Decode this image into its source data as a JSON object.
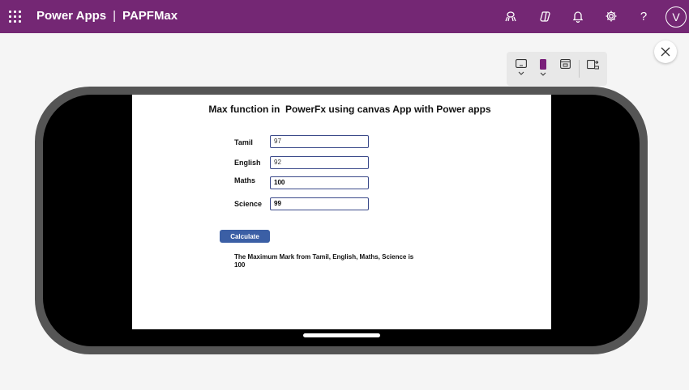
{
  "header": {
    "app_name": "Power Apps",
    "separator": "|",
    "project_name": "PAPFMax",
    "avatar_initial": "V"
  },
  "colors": {
    "header_bg": "#742774",
    "button_bg": "#3b5fa5",
    "input_border": "#3b4a8a"
  },
  "icons": {
    "waffle": "app-launcher-icon",
    "environment": "environment-icon",
    "copilot": "copilot-icon",
    "notifications": "bell-icon",
    "settings": "gear-icon",
    "help": "help-icon",
    "close": "close-icon"
  },
  "app": {
    "title": "Max function in  PowerFx using canvas App with Power apps",
    "fields": [
      {
        "label": "Tamil",
        "value": "97"
      },
      {
        "label": "English",
        "value": "92"
      },
      {
        "label": "Maths",
        "value": "100"
      },
      {
        "label": "Science",
        "value": "99"
      }
    ],
    "calculate_label": "Calculate",
    "result_line1": "The Maximum Mark from Tamil, English, Maths, Science is",
    "result_line2": "100"
  }
}
